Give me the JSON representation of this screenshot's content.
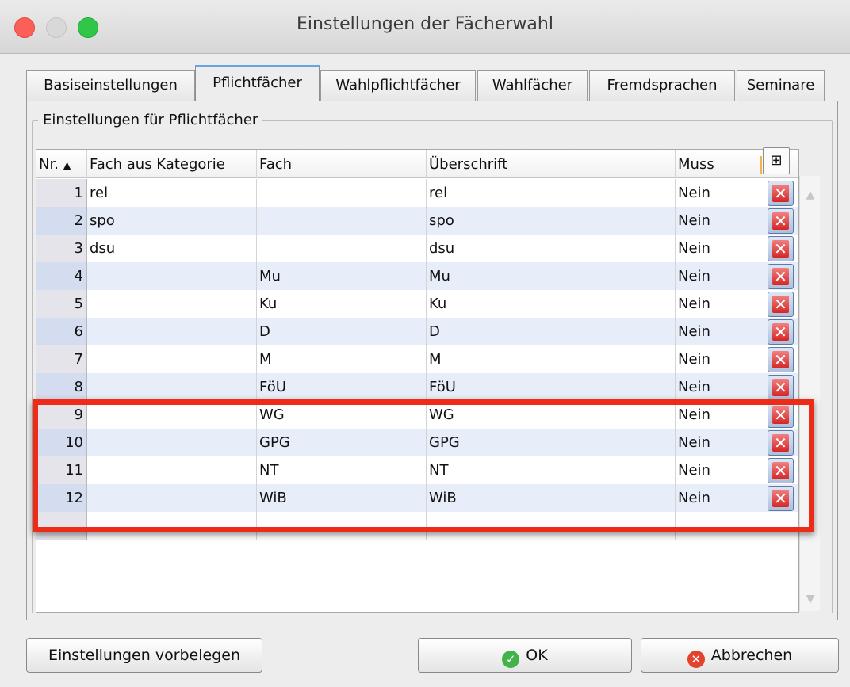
{
  "window": {
    "title": "Einstellungen der Fächerwahl"
  },
  "tabs": [
    {
      "label": "Basiseinstellungen",
      "active": false
    },
    {
      "label": "Pflichtfächer",
      "active": true
    },
    {
      "label": "Wahlpflichtfächer",
      "active": false
    },
    {
      "label": "Wahlfächer",
      "active": false
    },
    {
      "label": "Fremdsprachen",
      "active": false
    },
    {
      "label": "Seminare",
      "active": false
    }
  ],
  "group": {
    "title": "Einstellungen für Pflichtfächer"
  },
  "table": {
    "columns": [
      "Nr.",
      "Fach aus Kategorie",
      "Fach",
      "Überschrift",
      "Muss"
    ],
    "sort_indicator": "▲",
    "corner_icon": "column-chooser-icon",
    "corner_glyph": "⊞",
    "rows": [
      {
        "nr": "1",
        "kategorie": "rel",
        "fach": "",
        "ueberschrift": "rel",
        "muss": "Nein"
      },
      {
        "nr": "2",
        "kategorie": "spo",
        "fach": "",
        "ueberschrift": "spo",
        "muss": "Nein"
      },
      {
        "nr": "3",
        "kategorie": "dsu",
        "fach": "",
        "ueberschrift": "dsu",
        "muss": "Nein"
      },
      {
        "nr": "4",
        "kategorie": "",
        "fach": "Mu",
        "ueberschrift": "Mu",
        "muss": "Nein"
      },
      {
        "nr": "5",
        "kategorie": "",
        "fach": "Ku",
        "ueberschrift": "Ku",
        "muss": "Nein"
      },
      {
        "nr": "6",
        "kategorie": "",
        "fach": "D",
        "ueberschrift": "D",
        "muss": "Nein"
      },
      {
        "nr": "7",
        "kategorie": "",
        "fach": "M",
        "ueberschrift": "M",
        "muss": "Nein"
      },
      {
        "nr": "8",
        "kategorie": "",
        "fach": "FöU",
        "ueberschrift": "FöU",
        "muss": "Nein"
      },
      {
        "nr": "9",
        "kategorie": "",
        "fach": "WG",
        "ueberschrift": "WG",
        "muss": "Nein"
      },
      {
        "nr": "10",
        "kategorie": "",
        "fach": "GPG",
        "ueberschrift": "GPG",
        "muss": "Nein"
      },
      {
        "nr": "11",
        "kategorie": "",
        "fach": "NT",
        "ueberschrift": "NT",
        "muss": "Nein"
      },
      {
        "nr": "12",
        "kategorie": "",
        "fach": "WiB",
        "ueberschrift": "WiB",
        "muss": "Nein"
      }
    ],
    "delete_glyph": "✕"
  },
  "buttons": {
    "preset": "Einstellungen vorbelegen",
    "ok": "OK",
    "cancel": "Abbrechen",
    "ok_glyph": "✓",
    "cancel_glyph": "✕"
  },
  "colors": {
    "highlight": "#ee2b17",
    "active_tab_accent": "#6aa2e8",
    "row_alt": "#e8eef9"
  }
}
